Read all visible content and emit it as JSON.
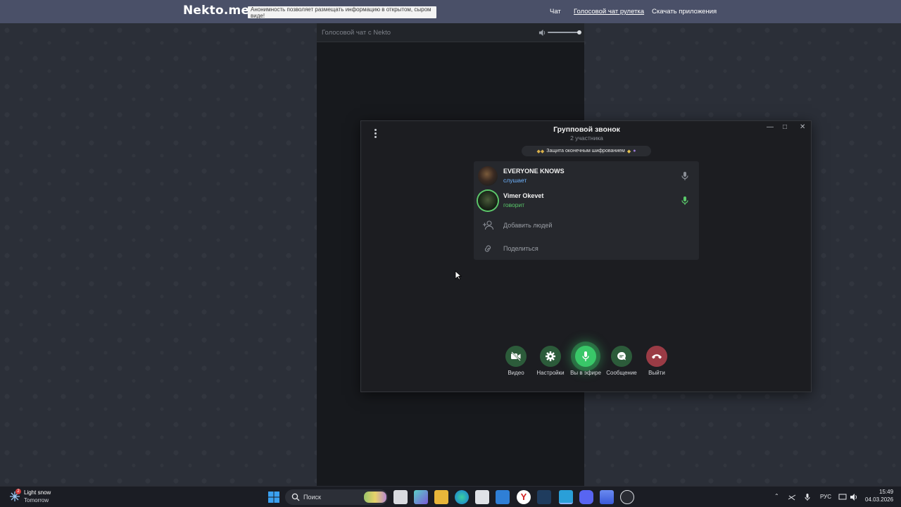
{
  "site": {
    "logo": "Nekto.me",
    "notice": "Анонимность позволяет размещать информацию в открытом, сыром виде!",
    "nav": [
      "Чат",
      "Голосовой чат рулетка",
      "Скачать приложения"
    ]
  },
  "chat": {
    "title": "Голосовой чат с Nekto"
  },
  "call": {
    "title": "Групповой звонок",
    "subtitle": "2 участника",
    "encryption": "Защита оконечным шифрованием",
    "participants": [
      {
        "name": "EVERYONE KNOWS",
        "status": "слушает"
      },
      {
        "name": "Vimer Okevet",
        "status": "говорит"
      }
    ],
    "actions": [
      "Добавить людей",
      "Поделиться"
    ],
    "controls": [
      {
        "label": "Видео",
        "icon": "video-off-icon"
      },
      {
        "label": "Настройки",
        "icon": "gear-icon"
      },
      {
        "label": "Вы в эфире",
        "icon": "microphone-icon"
      },
      {
        "label": "Сообщение",
        "icon": "message-icon"
      },
      {
        "label": "Выйти",
        "icon": "hang-up-icon"
      }
    ]
  },
  "taskbar": {
    "weather_title": "Light snow",
    "weather_sub": "Tomorrow",
    "weather_badge": "2",
    "search_placeholder": "Поиск",
    "lang": "РУС",
    "time": "15:49",
    "date": "04.03.2026"
  },
  "colors": {
    "header": "#4a5068",
    "speaking": "#59c86a",
    "listening": "#6fb4ff",
    "hangup": "#9a3b45"
  }
}
